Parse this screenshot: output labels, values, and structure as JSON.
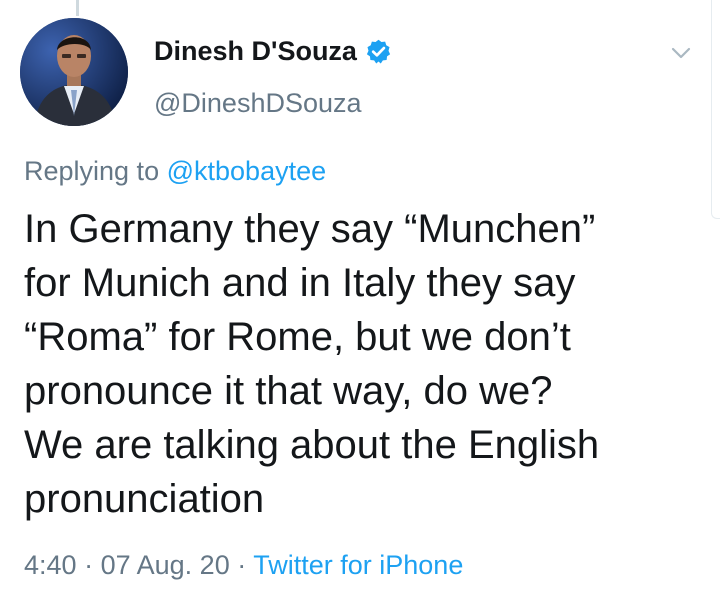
{
  "author": {
    "display_name": "Dinesh D'Souza",
    "handle": "@DineshDSouza",
    "verified": true,
    "avatar_icon": "profile-photo"
  },
  "reply": {
    "prefix": "Replying to",
    "handle": "@ktbobaytee"
  },
  "tweet": {
    "lines": [
      "In Germany they say “Munchen”",
      "for Munich and in Italy they say",
      "“Roma” for Rome, but we don’t",
      "pronounce it that way, do we?",
      "We are talking about the English",
      "pronunciation"
    ]
  },
  "meta": {
    "time": "4:40",
    "separator": "·",
    "date": "07 Aug. 20",
    "source": "Twitter for iPhone"
  },
  "colors": {
    "accent": "#1da1f2",
    "secondary_text": "#657786",
    "primary_text": "#14171a"
  }
}
